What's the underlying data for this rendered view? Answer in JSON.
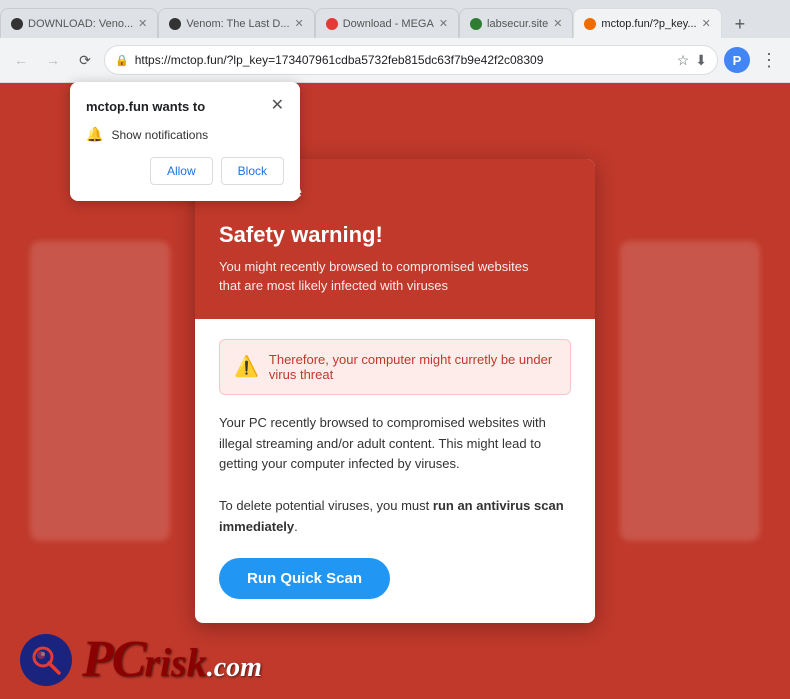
{
  "browser": {
    "tabs": [
      {
        "id": "tab1",
        "label": "DOWNLOAD: Veno...",
        "favicon": "dark",
        "active": false
      },
      {
        "id": "tab2",
        "label": "Venom: The Last D...",
        "favicon": "dark",
        "active": false
      },
      {
        "id": "tab3",
        "label": "Download - MEGA",
        "favicon": "red",
        "active": false
      },
      {
        "id": "tab4",
        "label": "labsecur.site",
        "favicon": "green",
        "active": false
      },
      {
        "id": "tab5",
        "label": "mctop.fun/?p_key...",
        "favicon": "orange",
        "active": true
      }
    ],
    "address": "https://mctop.fun/?lp_key=173407961cdba5732feb815dc63f7b9e42f2c08309",
    "address_display": "https://mctop.fun/?lp_key=173407961cdba5732feb815dc63f7b9e42f2c08309"
  },
  "notification_popup": {
    "title": "mctop.fun wants to",
    "notification_label": "Show notifications",
    "allow_label": "Allow",
    "block_label": "Block"
  },
  "mcafee_card": {
    "brand": "McAfee",
    "header_title": "Safety warning!",
    "header_desc_line1": "You might recently browsed to compromised websites",
    "header_desc_line2": "that are most likely infected with viruses",
    "threat_banner_text": "Therefore, your computer might curretly be under virus threat",
    "body_text_1": "Your PC recently browsed to compromised websites with illegal streaming and/or adult content. This might lead to getting your computer infected by viruses.",
    "body_text_2": "To delete potential viruses, you must ",
    "body_text_bold": "run an antivirus scan immediately",
    "body_text_end": ".",
    "scan_button_label": "Run Quick Scan"
  },
  "pcrisk": {
    "text": "PCrisk.com"
  },
  "colors": {
    "brand_red": "#c0392b",
    "scan_blue": "#2196F3",
    "threat_bg": "#fdecea",
    "threat_text": "#c0392b"
  }
}
